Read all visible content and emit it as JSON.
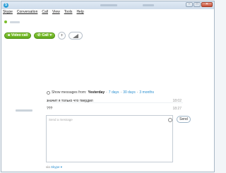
{
  "titlebar": {
    "app_icon_glyph": "S"
  },
  "window_controls": {
    "minimize": "–",
    "maximize": "□",
    "close": "✕"
  },
  "menu": [
    "Skype",
    "Conversation",
    "Call",
    "View",
    "Tools",
    "Help"
  ],
  "toolbar": {
    "video_call": "Video call",
    "call": "Call",
    "add": "+",
    "signal_icon": "signal-bars-icon"
  },
  "history": {
    "prefix": "Show messages from:",
    "current": "Yesterday",
    "sep1": "·",
    "opt1": "7 days",
    "sep2": "·",
    "opt2": "30 days",
    "sep3": "·",
    "opt3": "3 months"
  },
  "messages": [
    {
      "text": "значит я только что твердил",
      "time": "18:02"
    },
    {
      "text": "???",
      "time": "18:27"
    }
  ],
  "compose": {
    "placeholder": "Send a message",
    "send": "Send"
  },
  "footer": {
    "via": "via",
    "service": "Skype ▾"
  },
  "colors": {
    "accent_green": "#6fb82a",
    "link_blue": "#2a8fd0"
  }
}
